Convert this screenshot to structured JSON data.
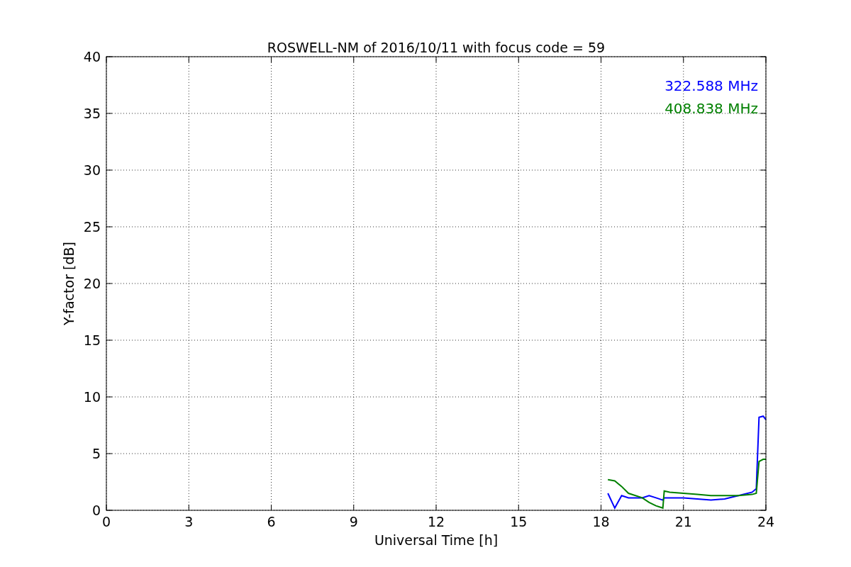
{
  "chart": {
    "chart_data": {
      "type": "line",
      "title": "ROSWELL-NM of 2016/10/11 with focus code = 59",
      "xlabel": "Universal Time [h]",
      "ylabel": "Y-factor [dB]",
      "x": [
        18.25,
        18.5,
        18.75,
        19,
        19.5,
        19.75,
        20,
        20.25,
        20.3,
        20.5,
        21,
        21.5,
        22,
        22.5,
        23,
        23.5,
        23.65,
        23.75,
        23.9,
        24
      ],
      "series": [
        {
          "name": "322.588 MHz",
          "color": "#0000ff",
          "values": [
            1.5,
            0.2,
            1.3,
            1.1,
            1.1,
            1.3,
            1.1,
            0.9,
            1.1,
            1.1,
            1.1,
            1.0,
            0.9,
            1.0,
            1.3,
            1.6,
            1.9,
            8.2,
            8.3,
            8.0
          ]
        },
        {
          "name": "408.838 MHz",
          "color": "#008000",
          "values": [
            2.7,
            2.6,
            2.1,
            1.5,
            1.1,
            0.7,
            0.4,
            0.2,
            1.7,
            1.6,
            1.5,
            1.4,
            1.3,
            1.3,
            1.3,
            1.4,
            1.5,
            4.3,
            4.5,
            4.5
          ]
        }
      ],
      "xlim": [
        0,
        24
      ],
      "ylim": [
        0,
        40
      ],
      "xticks": [
        0,
        3,
        6,
        9,
        12,
        15,
        18,
        21,
        24
      ],
      "yticks": [
        0,
        5,
        10,
        15,
        20,
        25,
        30,
        35,
        40
      ],
      "grid": true
    }
  }
}
